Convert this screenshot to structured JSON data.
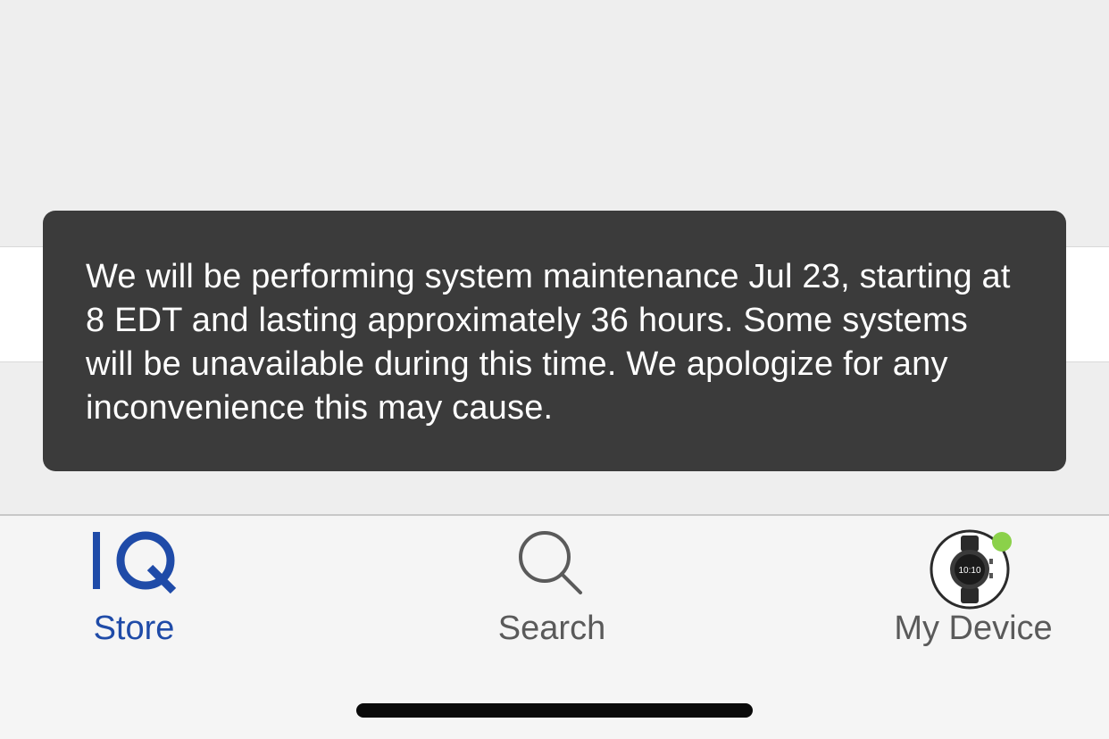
{
  "toast": {
    "message": "We will be performing system maintenance Jul 23, starting at 8 EDT and lasting approximately 36 hours. Some systems will be unavailable during this time. We apologize for any inconvenience this may cause."
  },
  "tabs": {
    "store": {
      "label": "Store",
      "icon": "iq-store-icon",
      "active": true
    },
    "search": {
      "label": "Search",
      "icon": "search-icon",
      "active": false
    },
    "device": {
      "label": "My Device",
      "icon": "watch-device-icon",
      "active": false,
      "connection_status": "connected"
    },
    "watch_face_time": "10:10"
  },
  "colors": {
    "accent": "#1f4ba8",
    "toast_background": "#3b3b3b",
    "status_dot": "#8bd14a",
    "inactive": "#5a5a5a"
  }
}
